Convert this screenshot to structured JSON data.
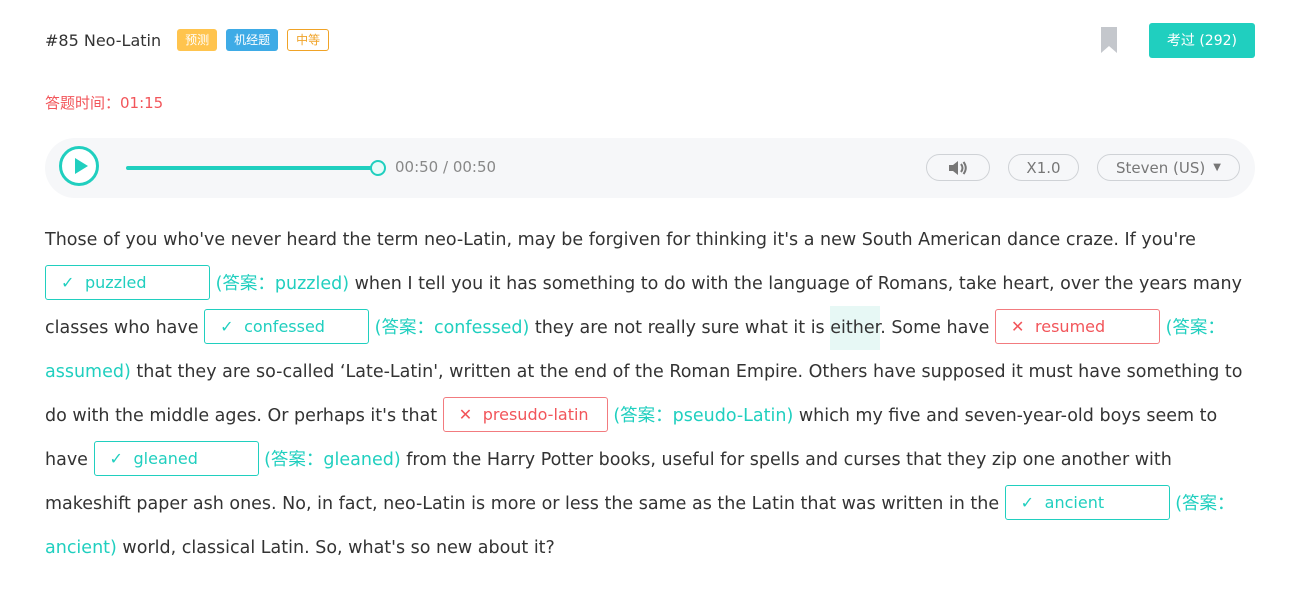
{
  "header": {
    "title": "#85 Neo-Latin",
    "tags": {
      "predict": "预测",
      "jj": "机经题",
      "level": "中等"
    },
    "passed_button": "考过 (292)"
  },
  "timer": "答题时间：01:15",
  "player": {
    "time": "00:50 / 00:50",
    "progress": 1.0,
    "speed": "X1.0",
    "voice": "Steven (US)"
  },
  "passage": {
    "t0": "Those of you who've never heard the term neo-Latin, may be forgiven for thinking it's a new South American dance craze. If you're ",
    "b1": {
      "mark": "✓",
      "value": "puzzled"
    },
    "a1": "(答案：puzzled)",
    "t1": " when I tell you it has something to do with the language of Romans, take heart, over the years many classes who have ",
    "b2": {
      "mark": "✓",
      "value": "confessed"
    },
    "a2": "(答案：confessed)",
    "t2a": " they are not really sure what it is ",
    "t2hl": "either",
    "t2b": ". Some have ",
    "b3": {
      "mark": "✕",
      "value": "resumed"
    },
    "a3": "(答案：assumed)",
    "t3": " that they are so-called ‘Late-Latin', written at the end of the Roman Empire. Others have supposed it must have something to do with the middle ages. Or perhaps it's that ",
    "b4": {
      "mark": "✕",
      "value": "presudo-latin"
    },
    "a4": "(答案：pseudo-Latin)",
    "t4": " which my five and seven-year-old boys seem to have ",
    "b5": {
      "mark": "✓",
      "value": "gleaned"
    },
    "a5": "(答案：gleaned)",
    "t5": " from the Harry Potter books, useful for spells and curses that they zip one another with makeshift paper ash ones. No, in fact, neo-Latin is more or less the same as the Latin that was written in the ",
    "b6": {
      "mark": "✓",
      "value": "ancient"
    },
    "a6": "(答案：ancient)",
    "t6": " world, classical Latin. So, what's so new about it?"
  },
  "colors": {
    "accent": "#20cfbf",
    "error": "#f2555a",
    "tag_predict": "#ffc44e",
    "tag_jj": "#3eabe6",
    "tag_level": "#f0a327"
  },
  "icons": {
    "bookmark": "bookmark-icon",
    "play": "play-icon",
    "volume": "volume-icon",
    "caret": "caret-down-icon",
    "check": "check-icon",
    "cross": "cross-icon"
  }
}
